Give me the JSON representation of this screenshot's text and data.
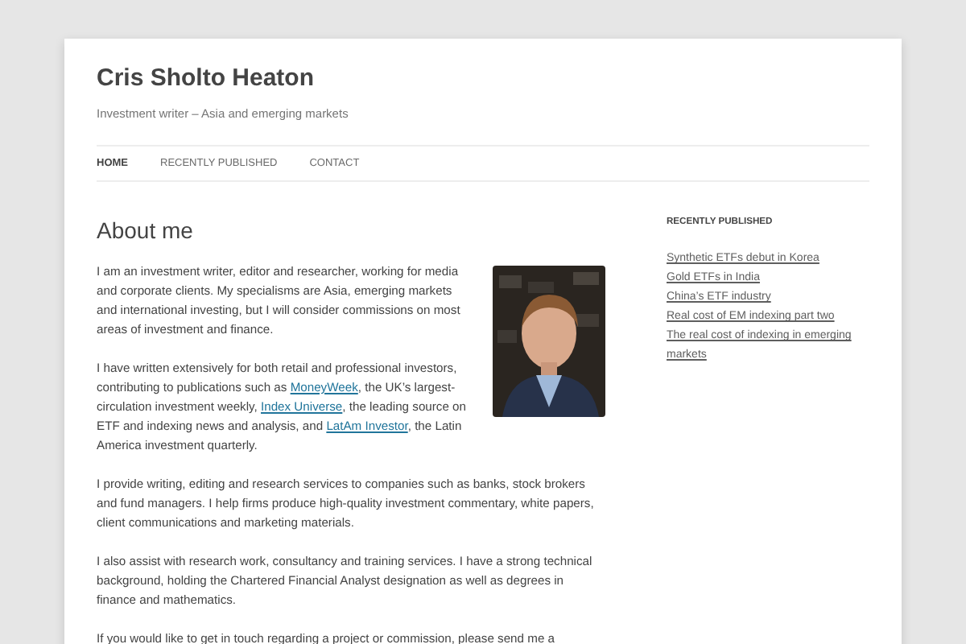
{
  "site": {
    "title": "Cris Sholto Heaton",
    "tagline": "Investment writer – Asia and emerging markets"
  },
  "nav": [
    {
      "label": "HOME",
      "selected": true
    },
    {
      "label": "RECENTLY PUBLISHED",
      "selected": false
    },
    {
      "label": "CONTACT",
      "selected": false
    }
  ],
  "page": {
    "heading": "About me",
    "paragraphs": [
      {
        "parts": [
          {
            "kind": "text",
            "text": "I am an investment writer, editor and researcher, working for media and corporate clients. My specialisms are Asia, emerging markets and international investing, but I will consider commissions on most areas of investment and finance."
          }
        ]
      },
      {
        "parts": [
          {
            "kind": "text",
            "text": "I have written extensively for both retail and professional investors, contributing to publications such as "
          },
          {
            "kind": "link",
            "text": "MoneyWeek"
          },
          {
            "kind": "text",
            "text": ", the UK’s largest-circulation investment weekly, "
          },
          {
            "kind": "link",
            "text": "Index Universe"
          },
          {
            "kind": "text",
            "text": ", the leading source on ETF and indexing news and analysis, and "
          },
          {
            "kind": "link",
            "text": "LatAm Investor"
          },
          {
            "kind": "text",
            "text": ", the Latin America investment quarterly."
          }
        ]
      },
      {
        "parts": [
          {
            "kind": "text",
            "text": "I provide writing, editing and research services to companies such as banks, stock brokers and fund managers. I help firms produce high-quality investment commentary, white papers, client communications and marketing materials."
          }
        ]
      },
      {
        "parts": [
          {
            "kind": "text",
            "text": "I also assist with research work, consultancy and training services. I have a strong technical background, holding the Chartered Financial Analyst designation as well as degrees in finance and mathematics."
          }
        ]
      },
      {
        "parts": [
          {
            "kind": "text",
            "text": "If you would like to get in touch regarding a project or commission, please send me a"
          }
        ]
      }
    ]
  },
  "sidebar": {
    "heading": "RECENTLY PUBLISHED",
    "links": [
      "Synthetic ETFs debut in Korea",
      "Gold ETFs in India",
      "China’s ETF industry",
      "Real cost of EM indexing part two",
      "The real cost of indexing in emerging markets"
    ]
  }
}
